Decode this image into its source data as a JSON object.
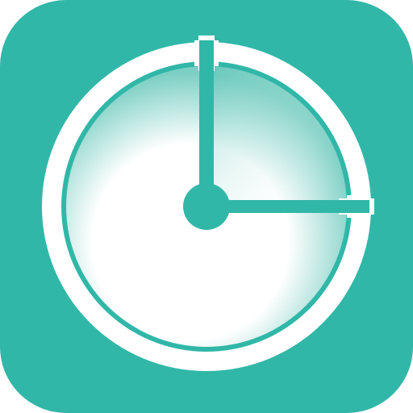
{
  "app_icon": {
    "icon": "clock-icon",
    "colors": {
      "background": "#31b7a8",
      "ring": "#ffffff",
      "accent": "#31b7a8",
      "face_inner": "#ffffff",
      "face_shade": "#7ccfc4",
      "quadrant_shade": "#58c3b6"
    }
  }
}
